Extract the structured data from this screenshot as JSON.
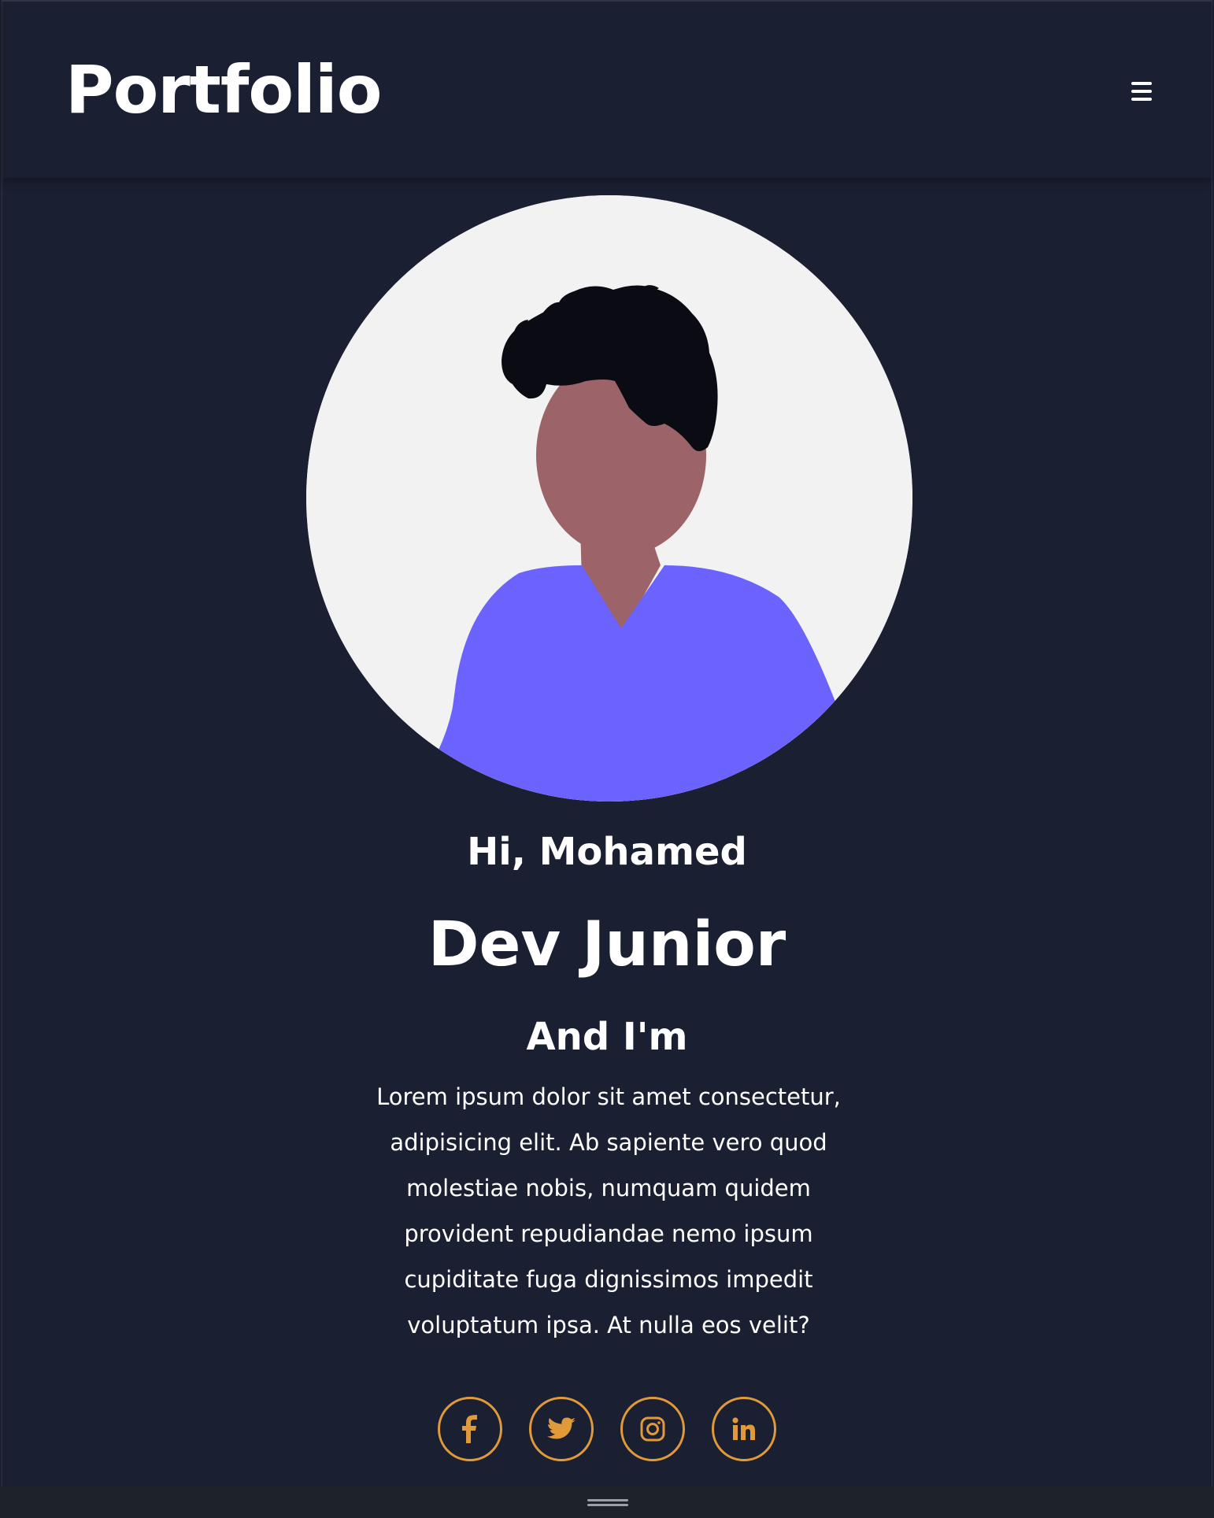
{
  "header": {
    "logo": "Portfolio",
    "menu_icon": "hamburger-icon"
  },
  "hero": {
    "avatar_alt": "avatar-illustration",
    "greeting": "Hi, Mohamed",
    "role": "Dev Junior",
    "subheading": "And I'm",
    "description": "Lorem ipsum dolor sit amet consectetur, adipisicing elit. Ab sapiente vero quod molestiae nobis, numquam quidem provident repudiandae nemo ipsum cupiditate fuga dignissimos impedit voluptatum ipsa. At nulla eos velit?"
  },
  "socials": [
    {
      "icon": "facebook-icon"
    },
    {
      "icon": "twitter-icon"
    },
    {
      "icon": "instagram-icon"
    },
    {
      "icon": "linkedin-icon"
    }
  ],
  "colors": {
    "background": "#1b1f32",
    "accent": "#e09a3a",
    "shirt": "#6c63ff",
    "skin": "#9c6369",
    "hair": "#0b0b14",
    "avatar_bg": "#f2f2f2",
    "text": "#ffffff"
  }
}
